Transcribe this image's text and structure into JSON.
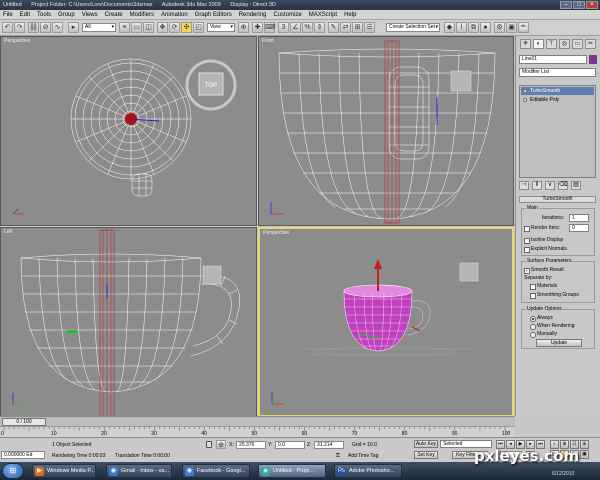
{
  "window": {
    "title": "Untitled",
    "project": "Project Folder: C:\\Users\\Lore\\Documents\\3dsmax",
    "app": "Autodesk 3ds Max  2009",
    "display": "Display : Direct 3D"
  },
  "menu": [
    "File",
    "Edit",
    "Tools",
    "Group",
    "Views",
    "Create",
    "Modifiers",
    "Animation",
    "Graph Editors",
    "Rendering",
    "Customize",
    "MAXScript",
    "Help"
  ],
  "toolbar": {
    "filter_value": "All",
    "coord_value": "View",
    "selection_set_placeholder": "Create Selection Set"
  },
  "viewports": [
    {
      "label": "Perspective",
      "active": false
    },
    {
      "label": "Front",
      "active": false
    },
    {
      "label": "Left",
      "active": false
    },
    {
      "label": "Perspective",
      "active": true
    }
  ],
  "viewcube": {
    "face": "TOP"
  },
  "command_panel": {
    "object_name": "Line01",
    "modifier_list": "Modifier List",
    "stack": [
      {
        "label": "TurboSmooth",
        "selected": true
      },
      {
        "label": "Editable Poly",
        "selected": false
      }
    ],
    "rollout_title": "TurboSmooth",
    "main": {
      "title": "Main",
      "iterations_label": "Iterations:",
      "iterations_value": "1",
      "render_iters_label": "Render Iters:",
      "render_iters_value": "0",
      "isoline_display": "Isoline Display",
      "explicit_normals": "Explicit Normals"
    },
    "surface": {
      "title": "Surface Parameters",
      "smooth_result": "Smooth Result",
      "separate_by": "Separate by:",
      "materials": "Materials",
      "smoothing_groups": "Smoothing Groups"
    },
    "update": {
      "title": "Update Options",
      "always": "Always",
      "when_rendering": "When Rendering",
      "manually": "Manually",
      "button": "Update"
    }
  },
  "timeline": {
    "frame_label": "0 / 100",
    "ticks": [
      "0",
      "10",
      "20",
      "30",
      "40",
      "50",
      "60",
      "70",
      "80",
      "90",
      "100"
    ]
  },
  "status": {
    "selected": "1 Object Selected",
    "rendering_time": "Rendering Time  0:00:03",
    "translation_time": "Translation Time  0:00:00",
    "prompt": "0.000000  Ed",
    "x": "20.376",
    "y": "0.0",
    "z": "31.214",
    "grid": "Grid = 10.0",
    "add_time_tag": "Add Time Tag",
    "auto_key": "Auto Key",
    "set_key": "Set Key",
    "key_filters": "Key Filters...",
    "key_mode": "Selected",
    "current_frame": "0"
  },
  "taskbar": {
    "items": [
      {
        "label": "Windows Media P...",
        "active": false,
        "icon_color": "#e36d1e"
      },
      {
        "label": "Gmail - Inbox - va...",
        "active": false,
        "icon_color": "#3a7ad8"
      },
      {
        "label": "Facebook - Googl...",
        "active": false,
        "icon_color": "#3a7ad8"
      },
      {
        "label": "Untitled   - Proje...",
        "active": true,
        "icon_color": "#3aa8a0"
      },
      {
        "label": "Adobe Photosho...",
        "active": false,
        "icon_color": "#2a4e9e"
      }
    ],
    "date": "6/12/2010"
  },
  "watermark": "pxleyes.com",
  "colors": {
    "viewport_bg": "#8c8c8c",
    "wire": "#ffffff",
    "cup_selected": "#c040c0",
    "active_border": "#e8d86a",
    "stack_selected": "#5f7fae"
  }
}
